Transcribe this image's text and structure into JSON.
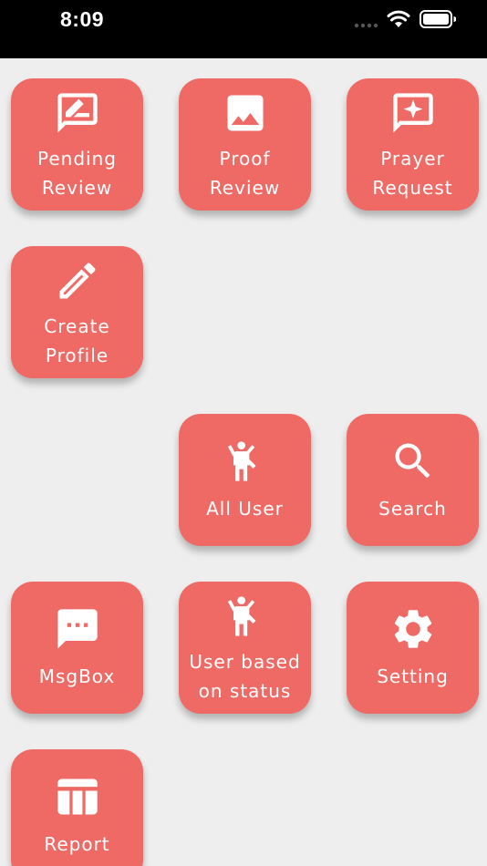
{
  "status_bar": {
    "time": "8:09",
    "icons": [
      "cellular-signal-icon",
      "wifi-icon",
      "battery-icon"
    ]
  },
  "theme": {
    "tile_color": "#ef6965",
    "background": "#eeeeee",
    "status_bar": "#000000"
  },
  "menu": [
    {
      "id": "pending-review",
      "line1": "Pending",
      "line2": "Review",
      "icon": "feedback-edit-icon"
    },
    {
      "id": "proof-review",
      "line1": "Proof",
      "line2": "Review",
      "icon": "image-icon"
    },
    {
      "id": "prayer-request",
      "line1": "Prayer",
      "line2": "Request",
      "icon": "sparkle-message-icon"
    },
    {
      "id": "create-profile",
      "line1": "Create",
      "line2": "Profile",
      "icon": "pencil-icon"
    },
    {
      "id": "all-user",
      "line1": "All User",
      "icon": "person-waving-icon"
    },
    {
      "id": "search",
      "line1": "Search",
      "icon": "search-icon"
    },
    {
      "id": "msgbox",
      "line1": "MsgBox",
      "icon": "chat-bubble-icon"
    },
    {
      "id": "user-based-on-status",
      "line1": "User based",
      "line2": "on status",
      "icon": "person-waving-icon"
    },
    {
      "id": "setting",
      "line1": "Setting",
      "icon": "gear-icon"
    },
    {
      "id": "report",
      "line1": "Report",
      "icon": "table-icon"
    }
  ]
}
